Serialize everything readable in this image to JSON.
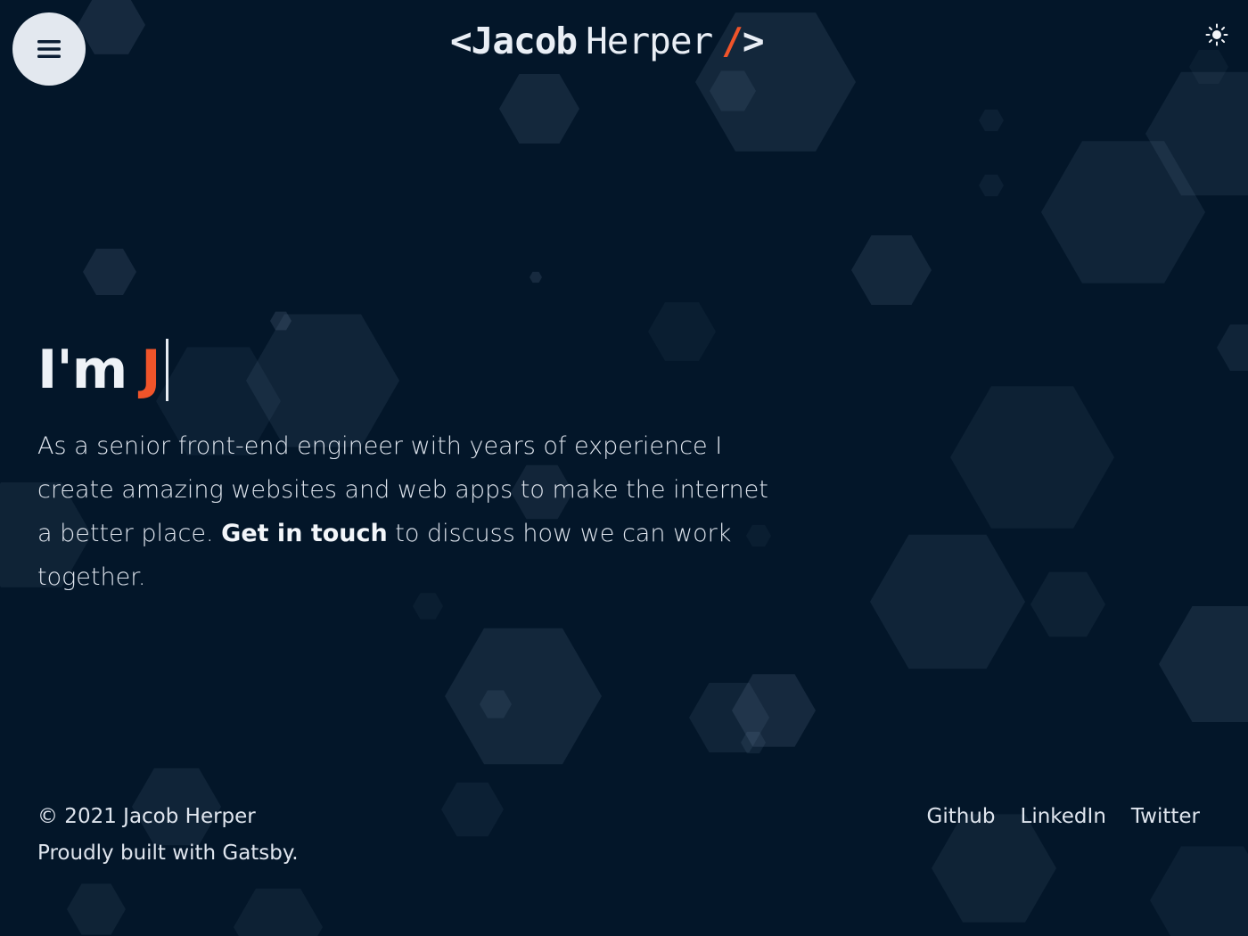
{
  "header": {
    "logo_open": "<Jacob",
    "logo_last": "Herper",
    "logo_slash": "/",
    "logo_close": ">",
    "theme_icon": "sun-icon",
    "menu_icon": "hamburger-menu-icon"
  },
  "hero": {
    "greeting_prefix": "I'm",
    "greeting_typed": "J",
    "bio_before": "As a senior front-end engineer with years of experience I create amazing websites and web apps to make the internet a better place. ",
    "bio_link": "Get in touch",
    "bio_after": " to discuss how we can work together."
  },
  "footer": {
    "copyright": "© 2021 Jacob Herper",
    "built_with": "Proudly built with Gatsby.",
    "links": [
      "Github",
      "LinkedIn",
      "Twitter"
    ]
  },
  "colors": {
    "background": "#031629",
    "accent": "#f0542a",
    "text": "#dfe5ee",
    "menu_button": "#e3e8ef"
  }
}
